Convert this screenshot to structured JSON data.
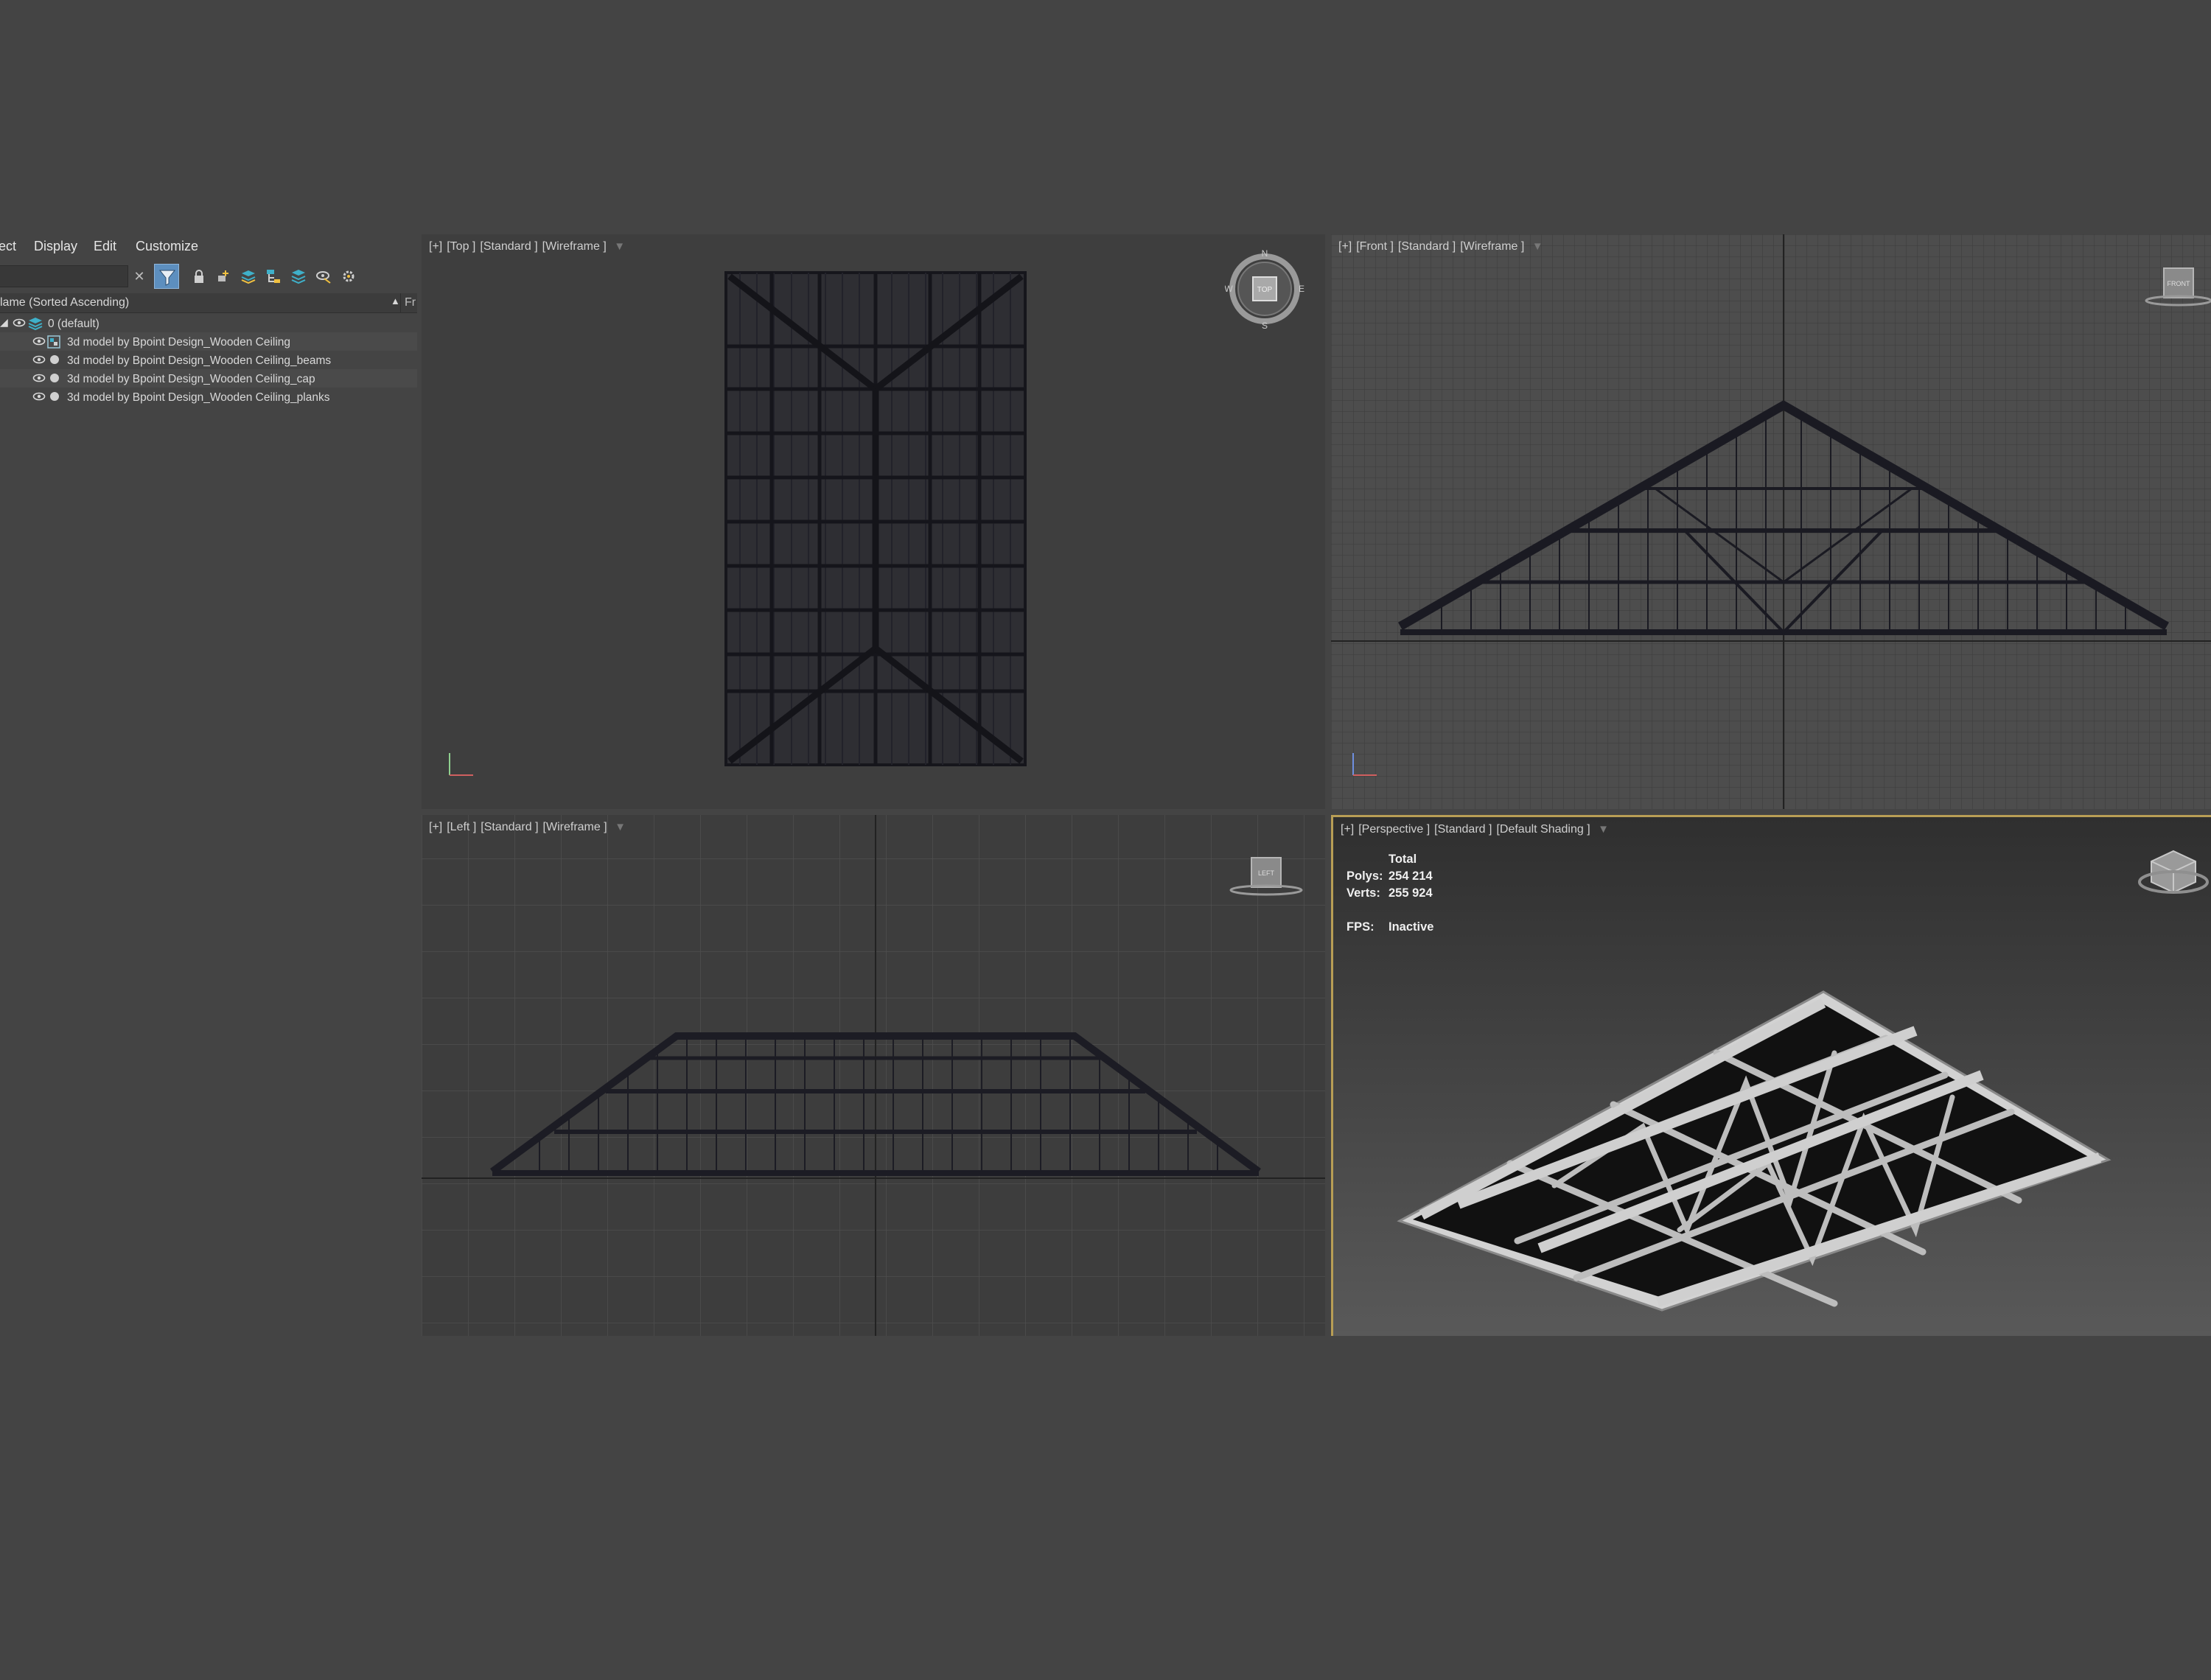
{
  "menu": {
    "items": [
      "ect",
      "Display",
      "Edit",
      "Customize"
    ]
  },
  "explorer": {
    "column_name": "lame (Sorted Ascending)",
    "column_fr": "Fr",
    "layer": "0 (default)",
    "objects": [
      "3d model by Bpoint Design_Wooden Ceiling",
      "3d model by Bpoint Design_Wooden Ceiling_beams",
      "3d model by Bpoint Design_Wooden Ceiling_cap",
      "3d model by Bpoint Design_Wooden Ceiling_planks"
    ]
  },
  "viewports": {
    "top": {
      "plus": "[+]",
      "view": "[Top ]",
      "mode": "[Standard ]",
      "shade": "[Wireframe ]",
      "cube": "TOP",
      "compass": {
        "n": "N",
        "s": "S",
        "e": "E",
        "w": "W"
      }
    },
    "front": {
      "plus": "[+]",
      "view": "[Front ]",
      "mode": "[Standard ]",
      "shade": "[Wireframe ]",
      "cube": "FRONT"
    },
    "left": {
      "plus": "[+]",
      "view": "[Left ]",
      "mode": "[Standard ]",
      "shade": "[Wireframe ]",
      "cube": "LEFT"
    },
    "perspective": {
      "plus": "[+]",
      "view": "[Perspective ]",
      "mode": "[Standard ]",
      "shade": "[Default Shading ]"
    }
  },
  "stats": {
    "total_label": "Total",
    "polys_label": "Polys:",
    "polys_value": "254 214",
    "verts_label": "Verts:",
    "verts_value": "255 924",
    "fps_label": "FPS:",
    "fps_value": "Inactive"
  },
  "colors": {
    "background": "#444444",
    "active_viewport_border": "#b89e55",
    "filter_button": "#5d8fbf",
    "layer_icon": "#3fb0c9",
    "wireframe": "#1c1c24"
  },
  "icons": [
    "clear-icon",
    "filter-icon",
    "lock-icon",
    "add-icon",
    "layers-icon",
    "hierarchy-icon",
    "stack-icon",
    "hide-icon",
    "settings-icon",
    "eye-icon",
    "layer-icon",
    "expand-icon",
    "viewport-filter-icon",
    "view-cube-icon",
    "compass-icon",
    "axis-tripod-icon"
  ]
}
